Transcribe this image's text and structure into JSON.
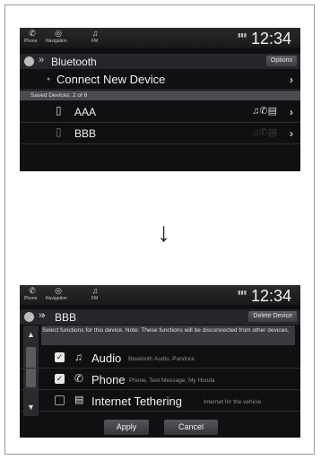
{
  "status_bar": {
    "phone_label": "Phone",
    "navigation_label": "Navigation",
    "fm_label": "FM",
    "clock": "12:34"
  },
  "screen1": {
    "header_title": "Bluetooth",
    "options_label": "Options",
    "connect_label": "Connect New Device",
    "saved_devices_label": "Saved Devices: 2 of 6",
    "devices": [
      "AAA",
      "BBB"
    ]
  },
  "screen2": {
    "header_title": "BBB",
    "delete_label": "Delete Device",
    "instruction": "Select functions for this device. Note: These functions will be disconnected from other devices.",
    "functions": [
      {
        "name": "Audio",
        "desc": "Bluetooth Audio, Pandora",
        "checked": true
      },
      {
        "name": "Phone",
        "desc": "Phone, Text Message, My Honda",
        "checked": true
      },
      {
        "name": "Internet Tethering",
        "desc": "Internet for the vehicle",
        "checked": false
      }
    ],
    "apply_label": "Apply",
    "cancel_label": "Cancel"
  }
}
